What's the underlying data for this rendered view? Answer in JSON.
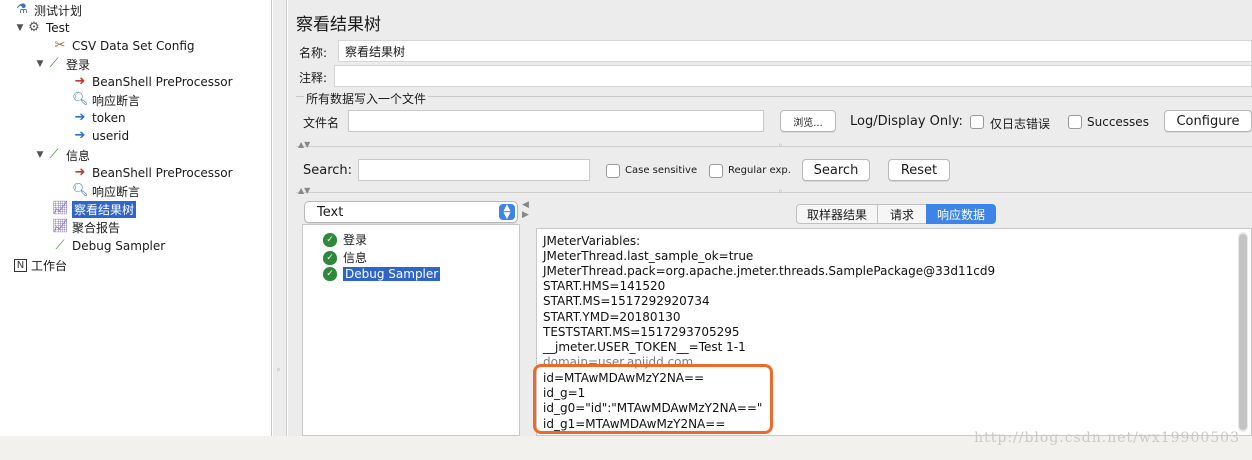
{
  "tree": {
    "items": [
      {
        "label": "测试计划",
        "icon": "flask-icon"
      },
      {
        "label": "Test",
        "icon": "gear-icon"
      },
      {
        "label": "CSV Data Set Config",
        "icon": "wrench-icon"
      },
      {
        "label": "登录",
        "icon": "dropper-icon"
      },
      {
        "label": "BeanShell PreProcessor",
        "icon": "arrow-in-icon"
      },
      {
        "label": "响应断言",
        "icon": "magnifier-icon"
      },
      {
        "label": "token",
        "icon": "doc-arrow-icon"
      },
      {
        "label": "userid",
        "icon": "doc-arrow-icon"
      },
      {
        "label": "信息",
        "icon": "dropper-icon"
      },
      {
        "label": "BeanShell PreProcessor",
        "icon": "arrow-in-icon"
      },
      {
        "label": "响应断言",
        "icon": "magnifier-icon"
      },
      {
        "label": "察看结果树",
        "icon": "chart-icon"
      },
      {
        "label": "聚合报告",
        "icon": "chart-icon"
      },
      {
        "label": "Debug Sampler",
        "icon": "dropper-icon"
      },
      {
        "label": "工作台",
        "icon": "workbench-icon"
      }
    ]
  },
  "panel": {
    "title": "察看结果树",
    "name_label": "名称:",
    "name_value": "察看结果树",
    "comment_label": "注释:",
    "comment_value": "",
    "group_title": "所有数据写入一个文件",
    "filename_label": "文件名",
    "filename_value": "",
    "browse_button": "浏览...",
    "log_display_label": "Log/Display Only:",
    "errors_only_label": "仅日志错误",
    "successes_label": "Successes",
    "configure_button": "Configure"
  },
  "search": {
    "label": "Search:",
    "value": "",
    "case_sensitive_label": "Case sensitive",
    "regex_label": "Regular exp.",
    "search_button": "Search",
    "reset_button": "Reset"
  },
  "renderer": {
    "selected": "Text"
  },
  "results": {
    "items": [
      {
        "label": "登录"
      },
      {
        "label": "信息"
      },
      {
        "label": "Debug Sampler"
      }
    ]
  },
  "tabs": {
    "sampler_result": "取样器结果",
    "request": "请求",
    "response_data": "响应数据"
  },
  "response": {
    "lines": [
      "JMeterVariables:",
      "JMeterThread.last_sample_ok=true",
      "JMeterThread.pack=org.apache.jmeter.threads.SamplePackage@33d11cd9",
      "START.HMS=141520",
      "START.MS=1517292920734",
      "START.YMD=20180130",
      "TESTSTART.MS=1517293705295",
      "__jmeter.USER_TOKEN__=Test 1-1",
      "domain=user.apijdd.com",
      "id=MTAwMDAwMzY2NA==",
      "id_g=1",
      "id_g0=\"id\":\"MTAwMDAwMzY2NA==\"",
      "id_g1=MTAwMDAwMzY2NA=="
    ]
  },
  "watermark": "http://blog.csdn.net/wx19900503",
  "colors": {
    "selection": "#2f65ca",
    "active_tab": "#3e83e8",
    "highlight_box": "#ef6a2a",
    "success_shield": "#2d8a3a"
  }
}
